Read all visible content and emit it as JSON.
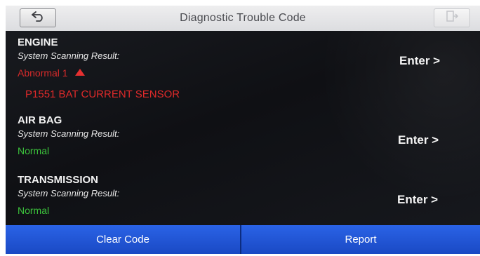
{
  "header": {
    "title": "Diagnostic Trouble Code"
  },
  "systems": [
    {
      "name": "ENGINE",
      "subtitle": "System Scanning Result:",
      "status": "Abnormal 1",
      "dtc": "P1551 BAT CURRENT SENSOR",
      "enter_label": "Enter >"
    },
    {
      "name": "AIR BAG",
      "subtitle": "System Scanning Result:",
      "status": "Normal",
      "enter_label": "Enter >"
    },
    {
      "name": "TRANSMISSION",
      "subtitle": "System Scanning Result:",
      "status": "Normal",
      "enter_label": "Enter >"
    }
  ],
  "footer": {
    "clear_label": "Clear Code",
    "report_label": "Report"
  },
  "icons": {
    "back": "back-arrow-icon",
    "exit": "exit-door-icon",
    "abnormal_indicator": "triangle-up-icon"
  },
  "colors": {
    "abnormal": "#d62a2a",
    "normal": "#3cc23c",
    "button_blue": "#2a63e6"
  }
}
